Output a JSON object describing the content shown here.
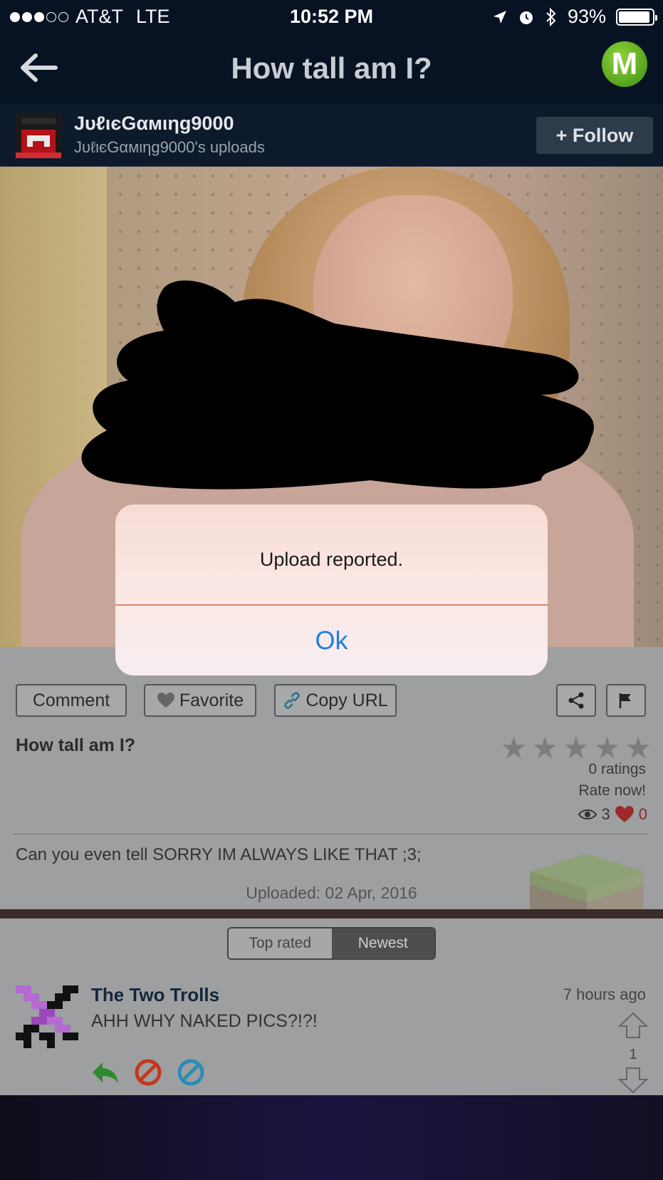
{
  "status_bar": {
    "carrier": "AT&T",
    "network": "LTE",
    "time": "10:52 PM",
    "battery": "93%",
    "battery_level": 0.93
  },
  "navbar": {
    "title": "How tall am I?",
    "logo_letter": "M"
  },
  "uploader": {
    "name": "JυℓιєGαмιηg9000",
    "subtitle": "JυℓιєGαмιηg9000's uploads",
    "follow_label": "+ Follow"
  },
  "actions": {
    "comment": "Comment",
    "favorite": "Favorite",
    "copy_url": "Copy URL"
  },
  "post": {
    "title": "How tall am I?",
    "ratings": "0 ratings",
    "rate_now": "Rate now!",
    "views": "3",
    "favorites": "0",
    "description": "Can you even tell SORRY IM ALWAYS LIKE THAT ;3;",
    "uploaded": "Uploaded: 02 Apr, 2016",
    "star_count": 5
  },
  "comments": {
    "tabs": [
      "Top rated",
      "Newest"
    ],
    "selected_tab": "Newest",
    "items": [
      {
        "author": "The Two Trolls",
        "time": "7 hours ago",
        "text": "AHH WHY NAKED PICS?!?!",
        "score": "1"
      }
    ]
  },
  "alert": {
    "message": "Upload reported.",
    "ok_label": "Ok"
  },
  "colors": {
    "accent_blue": "#1f7fe0",
    "logo_green": "#5cb324",
    "navbar_bg": "#071323"
  }
}
